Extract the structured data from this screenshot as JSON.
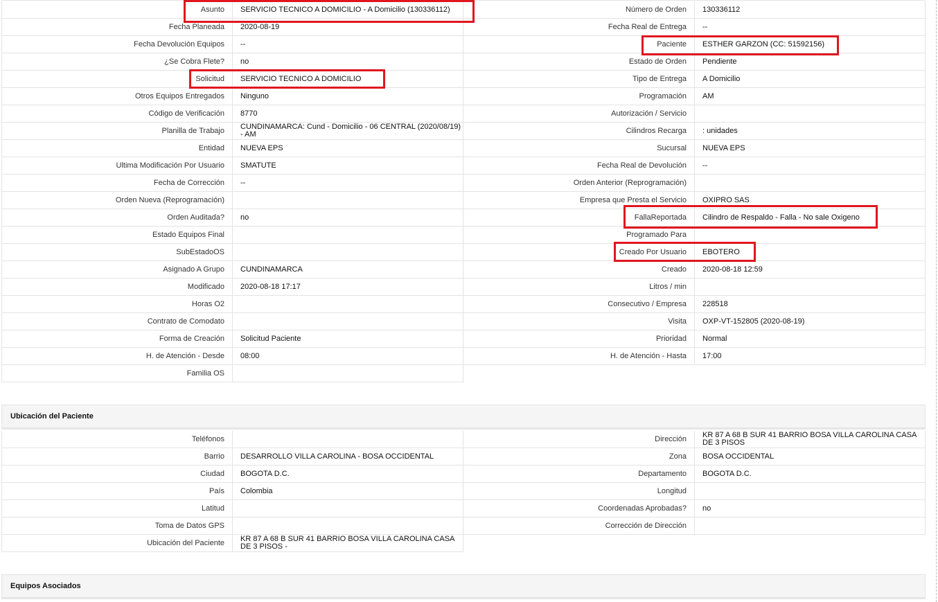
{
  "order": {
    "rows": [
      {
        "l1": "Asunto",
        "v1": "SERVICIO TECNICO A DOMICILIO - A Domicilio (130336112)",
        "l2": "Número de Orden",
        "v2": "130336112"
      },
      {
        "l1": "Fecha Planeada",
        "v1": "2020-08-19",
        "l2": "Fecha Real de Entrega",
        "v2": "--"
      },
      {
        "l1": "Fecha Devolución Equipos",
        "v1": "--",
        "l2": "Paciente",
        "v2": "ESTHER GARZON (CC: 51592156)"
      },
      {
        "l1": "¿Se Cobra Flete?",
        "v1": "no",
        "l2": "Estado de Orden",
        "v2": "Pendiente"
      },
      {
        "l1": "Solicitud",
        "v1": "SERVICIO TECNICO A DOMICILIO",
        "l2": "Tipo de Entrega",
        "v2": "A Domicilio"
      },
      {
        "l1": "Otros Equipos Entregados",
        "v1": "Ninguno",
        "l2": "Programación",
        "v2": "AM"
      },
      {
        "l1": "Código de Verificación",
        "v1": "8770",
        "l2": "Autorización / Servicio",
        "v2": ""
      },
      {
        "l1": "Planilla de Trabajo",
        "v1": "CUNDINAMARCA: Cund - Domicilio - 06 CENTRAL (2020/08/19) - AM",
        "l2": "Cilindros Recarga",
        "v2": ": unidades"
      },
      {
        "l1": "Entidad",
        "v1": "NUEVA EPS",
        "l2": "Sucursal",
        "v2": "NUEVA EPS"
      },
      {
        "l1": "Ultima Modificación Por Usuario",
        "v1": "SMATUTE",
        "l2": "Fecha Real de Devolución",
        "v2": "--"
      },
      {
        "l1": "Fecha de Corrección",
        "v1": "--",
        "l2": "Orden Anterior (Reprogramación)",
        "v2": ""
      },
      {
        "l1": "Orden Nueva (Reprogramación)",
        "v1": "",
        "l2": "Empresa que Presta el Servicio",
        "v2": "OXIPRO SAS"
      },
      {
        "l1": "Orden Auditada?",
        "v1": "no",
        "l2": "FallaReportada",
        "v2": "Cilindro de Respaldo - Falla - No sale Oxigeno"
      },
      {
        "l1": "Estado Equipos Final",
        "v1": "",
        "l2": "Programado Para",
        "v2": ""
      },
      {
        "l1": "SubEstadoOS",
        "v1": "",
        "l2": "Creado Por Usuario",
        "v2": "EBOTERO"
      },
      {
        "l1": "Asignado A Grupo",
        "v1": "CUNDINAMARCA",
        "l2": "Creado",
        "v2": "2020-08-18 12:59"
      },
      {
        "l1": "Modificado",
        "v1": "2020-08-18 17:17",
        "l2": "Litros / min",
        "v2": ""
      },
      {
        "l1": "Horas O2",
        "v1": "",
        "l2": "Consecutivo / Empresa",
        "v2": "228518"
      },
      {
        "l1": "Contrato de Comodato",
        "v1": "",
        "l2": "Visita",
        "v2": "OXP-VT-152805 (2020-08-19)"
      },
      {
        "l1": "Forma de Creación",
        "v1": "Solicitud Paciente",
        "l2": "Prioridad",
        "v2": "Normal"
      },
      {
        "l1": "H. de Atención - Desde",
        "v1": "08:00",
        "l2": "H. de Atención - Hasta",
        "v2": "17:00"
      }
    ],
    "last_label": "Familia OS",
    "last_value": ""
  },
  "location": {
    "title": "Ubicación del Paciente",
    "rows": [
      {
        "l1": "Teléfonos",
        "v1": "",
        "l2": "Dirección",
        "v2": "KR 87 A 68 B SUR 41 BARRIO BOSA VILLA CAROLINA CASA DE 3 PISOS"
      },
      {
        "l1": "Barrio",
        "v1": "DESARROLLO VILLA CAROLINA - BOSA OCCIDENTAL",
        "l2": "Zona",
        "v2": "BOSA OCCIDENTAL"
      },
      {
        "l1": "Ciudad",
        "v1": "BOGOTA D.C.",
        "l2": "Departamento",
        "v2": "BOGOTA D.C."
      },
      {
        "l1": "País",
        "v1": "Colombia",
        "l2": "Longitud",
        "v2": ""
      },
      {
        "l1": "Latitud",
        "v1": "",
        "l2": "Coordenadas Aprobadas?",
        "v2": "no"
      },
      {
        "l1": "Toma de Datos GPS",
        "v1": "",
        "l2": "Corrección de Dirección",
        "v2": ""
      }
    ],
    "last_label": "Ubicación del Paciente",
    "last_value": "KR 87 A 68 B SUR 41 BARRIO BOSA VILLA CAROLINA CASA DE 3 PISOS -"
  },
  "equipment": {
    "title": "Equipos Asociados"
  },
  "colors": {
    "highlight": "#e0151f",
    "border": "#e3e3e3",
    "section_bg": "#f5f5f5"
  }
}
